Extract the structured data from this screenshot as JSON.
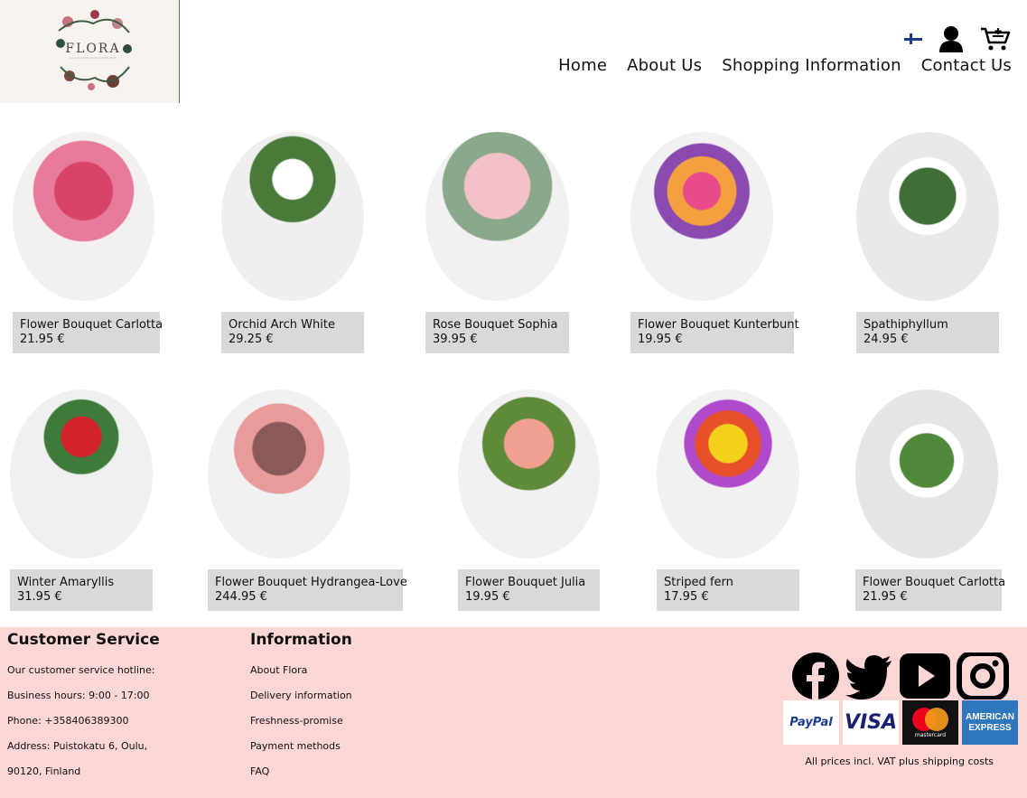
{
  "header": {
    "logo_text": "FLORA",
    "nav": [
      "Home",
      "About Us",
      "Shopping Information",
      "Contact Us"
    ],
    "icons": [
      "finland-flag-icon",
      "user-icon",
      "cart-icon"
    ]
  },
  "products": [
    {
      "name": "Flower Bouquet Carlotta",
      "price": "21.95 €"
    },
    {
      "name": "Orchid Arch White",
      "price": "29.25 €"
    },
    {
      "name": "Rose Bouquet Sophia",
      "price": "39.95 €"
    },
    {
      "name": "Flower Bouquet Kunterbunt",
      "price": "19.95 €"
    },
    {
      "name": "Spathiphyllum",
      "price": "24.95 €"
    },
    {
      "name": "Winter Amaryllis",
      "price": "31.95 €"
    },
    {
      "name": "Flower Bouquet Hydrangea-Love",
      "price": "244.95 €"
    },
    {
      "name": "Flower Bouquet Julia",
      "price": "19.95 €"
    },
    {
      "name": "Striped fern",
      "price": "17.95 €"
    },
    {
      "name": "Flower Bouquet Carlotta",
      "price": "21.95 €"
    }
  ],
  "footer": {
    "customer_service": {
      "title": "Customer Service",
      "lines": [
        "Our customer service hotline:",
        "Business hours: 9:00 - 17:00",
        "Phone: +358406389300",
        "Address: Puistokatu 6, Oulu,",
        "90120, Finland"
      ]
    },
    "information": {
      "title": "Information",
      "links": [
        "About Flora",
        "Delivery information",
        "Freshness-promise",
        "Payment methods",
        "FAQ"
      ]
    },
    "social_icons": [
      "facebook-icon",
      "twitter-icon",
      "youtube-icon",
      "instagram-icon"
    ],
    "payments": {
      "paypal": "PayPal",
      "visa": "VISA",
      "mastercard": "mastercard",
      "amex_1": "AMERICAN",
      "amex_2": "EXPRESS"
    },
    "note": "All prices incl. VAT plus shipping costs"
  },
  "colors": {
    "footer_bg": "#fdd6d6",
    "label_bg": "#d9d9d9",
    "logo_bg": "#f7f3ef",
    "flag_blue": "#1b3c8e"
  }
}
